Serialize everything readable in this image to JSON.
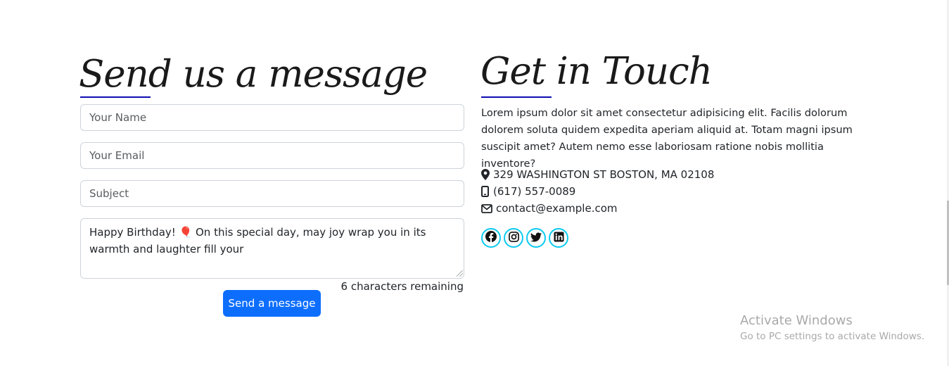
{
  "form": {
    "title": "Send us a message",
    "name_placeholder": "Your Name",
    "email_placeholder": "Your Email",
    "subject_placeholder": "Subject",
    "message_value": "Happy Birthday! 🎈 On this special day, may joy wrap you in its warmth and laughter fill your ",
    "char_count": "6 characters remaining",
    "send_label": "Send a message"
  },
  "contact": {
    "title": "Get in Touch",
    "intro": "Lorem ipsum dolor sit amet consectetur adipisicing elit. Facilis dolorum dolorem soluta quidem expedita aperiam aliquid at. Totam magni ipsum suscipit amet? Autem nemo esse laboriosam ratione nobis mollitia inventore?",
    "address": "329 WASHINGTON ST BOSTON, MA 02108",
    "phone": "(617) 557-0089",
    "email": "contact@example.com"
  },
  "socials": [
    "facebook-icon",
    "instagram-icon",
    "twitter-icon",
    "linkedin-icon"
  ],
  "watermark": {
    "title": "Activate Windows",
    "subtitle": "Go to PC settings to activate Windows."
  },
  "colors": {
    "accent_underline": "#0d0db4",
    "button": "#0d6efd",
    "social_ring": "#0dcaf0"
  }
}
